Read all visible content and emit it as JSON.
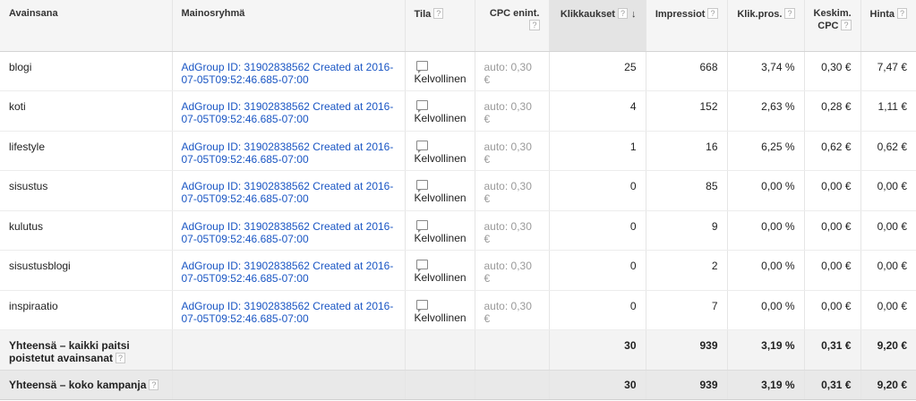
{
  "headers": {
    "keyword": "Avainsana",
    "adgroup": "Mainosryhmä",
    "status": "Tila",
    "cpc_max": "CPC enint.",
    "clicks": "Klikkaukset",
    "impressions": "Impressiot",
    "ctr": "Klik.pros.",
    "avg_cpc_line1": "Keskim.",
    "avg_cpc_line2": "CPC",
    "cost": "Hinta",
    "help": "?",
    "sort_arrow": "↓"
  },
  "rows": [
    {
      "keyword": "blogi",
      "adgroup": "AdGroup ID: 31902838562 Created at 2016-07-05T09:52:46.685-07:00",
      "status": "Kelvollinen",
      "cpc_max": "auto: 0,30 €",
      "clicks": "25",
      "impressions": "668",
      "ctr": "3,74 %",
      "avg_cpc": "0,30 €",
      "cost": "7,47 €"
    },
    {
      "keyword": "koti",
      "adgroup": "AdGroup ID: 31902838562 Created at 2016-07-05T09:52:46.685-07:00",
      "status": "Kelvollinen",
      "cpc_max": "auto: 0,30 €",
      "clicks": "4",
      "impressions": "152",
      "ctr": "2,63 %",
      "avg_cpc": "0,28 €",
      "cost": "1,11 €"
    },
    {
      "keyword": "lifestyle",
      "adgroup": "AdGroup ID: 31902838562 Created at 2016-07-05T09:52:46.685-07:00",
      "status": "Kelvollinen",
      "cpc_max": "auto: 0,30 €",
      "clicks": "1",
      "impressions": "16",
      "ctr": "6,25 %",
      "avg_cpc": "0,62 €",
      "cost": "0,62 €"
    },
    {
      "keyword": "sisustus",
      "adgroup": "AdGroup ID: 31902838562 Created at 2016-07-05T09:52:46.685-07:00",
      "status": "Kelvollinen",
      "cpc_max": "auto: 0,30 €",
      "clicks": "0",
      "impressions": "85",
      "ctr": "0,00 %",
      "avg_cpc": "0,00 €",
      "cost": "0,00 €"
    },
    {
      "keyword": "kulutus",
      "adgroup": "AdGroup ID: 31902838562 Created at 2016-07-05T09:52:46.685-07:00",
      "status": "Kelvollinen",
      "cpc_max": "auto: 0,30 €",
      "clicks": "0",
      "impressions": "9",
      "ctr": "0,00 %",
      "avg_cpc": "0,00 €",
      "cost": "0,00 €"
    },
    {
      "keyword": "sisustusblogi",
      "adgroup": "AdGroup ID: 31902838562 Created at 2016-07-05T09:52:46.685-07:00",
      "status": "Kelvollinen",
      "cpc_max": "auto: 0,30 €",
      "clicks": "0",
      "impressions": "2",
      "ctr": "0,00 %",
      "avg_cpc": "0,00 €",
      "cost": "0,00 €"
    },
    {
      "keyword": "inspiraatio",
      "adgroup": "AdGroup ID: 31902838562 Created at 2016-07-05T09:52:46.685-07:00",
      "status": "Kelvollinen",
      "cpc_max": "auto: 0,30 €",
      "clicks": "0",
      "impressions": "7",
      "ctr": "0,00 %",
      "avg_cpc": "0,00 €",
      "cost": "0,00 €"
    }
  ],
  "totals": [
    {
      "label": "Yhteensä – kaikki paitsi poistetut avainsanat",
      "clicks": "30",
      "impressions": "939",
      "ctr": "3,19 %",
      "avg_cpc": "0,31 €",
      "cost": "9,20 €"
    },
    {
      "label": "Yhteensä – koko kampanja",
      "clicks": "30",
      "impressions": "939",
      "ctr": "3,19 %",
      "avg_cpc": "0,31 €",
      "cost": "9,20 €"
    }
  ]
}
